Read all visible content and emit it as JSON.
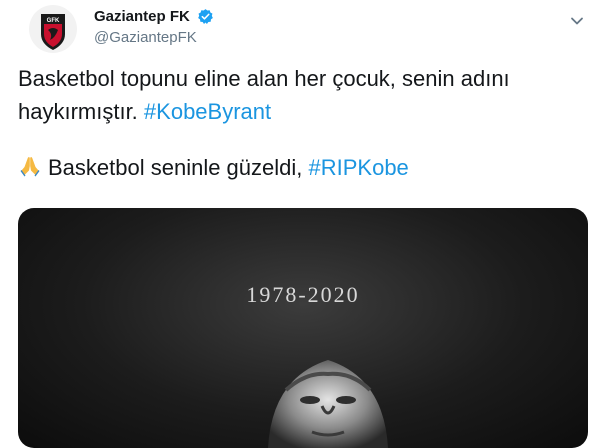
{
  "account": {
    "display_name": "Gaziantep FK",
    "handle": "@GaziantepFK",
    "verified": true,
    "avatar_text": "GFK"
  },
  "tweet": {
    "line1": "Basketbol topunu eline alan her çocuk, senin adını",
    "line2_text": "haykırmıştır. ",
    "line2_hashtag": "#KobeByrant",
    "line3_emoji": "folded-hands-emoji",
    "line3_text": "Basketbol seninle güzeldi, ",
    "line3_hashtag": "#RIPKobe"
  },
  "media": {
    "years": "1978-2020"
  },
  "colors": {
    "hashtag": "#1b95e0",
    "verified": "#1da1f2",
    "handle": "#657786",
    "club_red": "#c8102e"
  },
  "icons": [
    "verified-badge-icon",
    "chevron-down-icon",
    "folded-hands-emoji"
  ]
}
